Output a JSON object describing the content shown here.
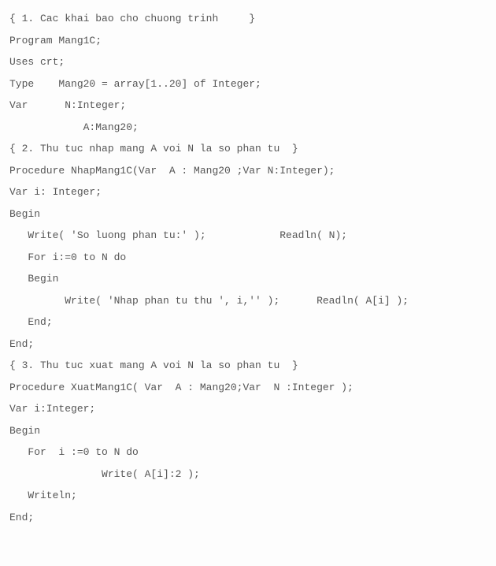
{
  "code": {
    "lines": [
      "{ 1. Cac khai bao cho chuong trinh     }",
      "Program Mang1C;",
      "Uses crt;",
      "Type    Mang20 = array[1..20] of Integer;",
      "Var      N:Integer;",
      "            A:Mang20;",
      "{ 2. Thu tuc nhap mang A voi N la so phan tu  }",
      "Procedure NhapMang1C(Var  A : Mang20 ;Var N:Integer);",
      "Var i: Integer;",
      "Begin",
      "   Write( 'So luong phan tu:' );            Readln( N);",
      "   For i:=0 to N do",
      "   Begin",
      "         Write( 'Nhap phan tu thu ', i,'' );      Readln( A[i] );",
      "   End;",
      "End;",
      "",
      "{ 3. Thu tuc xuat mang A voi N la so phan tu  }",
      "Procedure XuatMang1C( Var  A : Mang20;Var  N :Integer );",
      "Var i:Integer;",
      "Begin",
      "   For  i :=0 to N do",
      "               Write( A[i]:2 );",
      "   Writeln;",
      "End;"
    ]
  }
}
